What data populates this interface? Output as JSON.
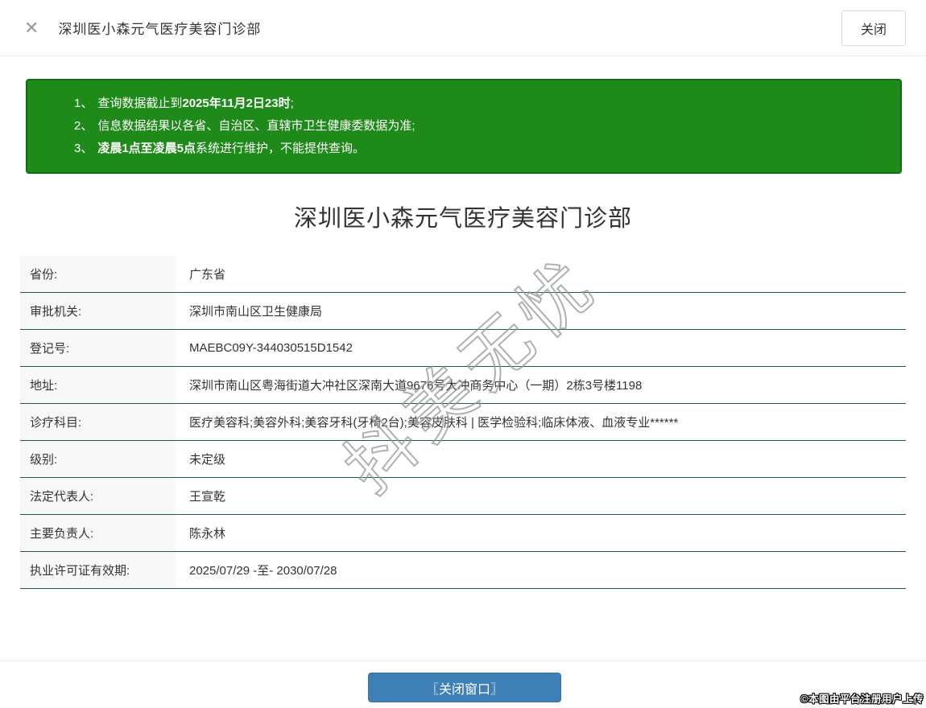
{
  "header": {
    "close_x": "✕",
    "title": "深圳医小森元气医疗美容门诊部",
    "close_button_label": "关闭"
  },
  "notice": {
    "items": [
      {
        "num": "1、",
        "pre": "查询数据截止到",
        "bold": "2025年11月2日23时",
        "post": ";"
      },
      {
        "num": "2、",
        "pre": "信息数据结果以各省、自治区、直辖市卫生健康委数据为准;",
        "bold": "",
        "post": ""
      },
      {
        "num": "3、",
        "pre": "",
        "bold": "凌晨1点至凌晨5点",
        "post": "系统进行维护，不能提供查询。"
      }
    ]
  },
  "main": {
    "title": "深圳医小森元气医疗美容门诊部"
  },
  "table": {
    "rows": [
      {
        "label": "省份:",
        "value": "广东省"
      },
      {
        "label": "审批机关:",
        "value": "深圳市南山区卫生健康局"
      },
      {
        "label": "登记号:",
        "value": "MAEBC09Y-344030515D1542"
      },
      {
        "label": "地址:",
        "value": "深圳市南山区粤海街道大冲社区深南大道9676号大冲商务中心（一期）2栋3号楼1198"
      },
      {
        "label": "诊疗科目:",
        "value": "医疗美容科;美容外科;美容牙科(牙椅2台);美容皮肤科 | 医学检验科;临床体液、血液专业******"
      },
      {
        "label": "级别:",
        "value": "未定级"
      },
      {
        "label": "法定代表人:",
        "value": "王宣乾"
      },
      {
        "label": "主要负责人:",
        "value": "陈永林"
      },
      {
        "label": "执业许可证有效期:",
        "value": "2025/07/29 -至- 2030/07/28"
      }
    ]
  },
  "watermark": "抖美无忧",
  "footer": {
    "close_window_button": "〖关闭窗口〗",
    "copyright": "©本图由平台注册用户上传"
  },
  "colors": {
    "notice_green": "#1e8a1a",
    "notice_border_green": "#0f6e0f",
    "row_divider_teal": "#20594f",
    "button_blue": "#3e80b6"
  }
}
